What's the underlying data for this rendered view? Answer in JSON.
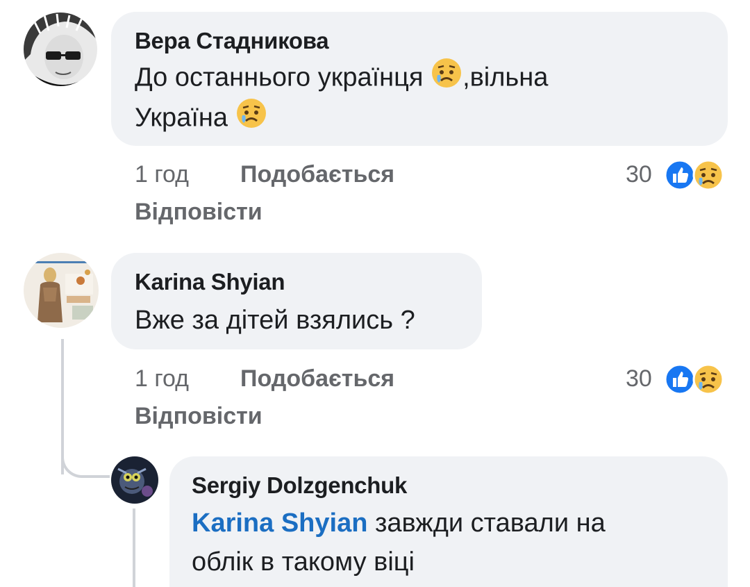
{
  "comments": [
    {
      "author": "Вера Стадникова",
      "text_line1_a": "До останнього українця",
      "text_line1_b": ",вільна",
      "text_line2": "Україна",
      "time": "1 год",
      "like_label": "Подобається",
      "reply_label": "Відповісти",
      "reaction_count": "30"
    },
    {
      "author": "Karina Shyian",
      "text": "Вже за дітей взялись ?",
      "time": "1 год",
      "like_label": "Подобається",
      "reply_label": "Відповісти",
      "reaction_count": "30"
    }
  ],
  "reply": {
    "author": "Sergiy Dolzgenchuk",
    "mention": "Karina Shyian",
    "text_line1": "завжди ставали на",
    "text_line2": "облік в такому віці"
  },
  "colors": {
    "bubble": "#f0f2f5",
    "like_blue": "#1877f2",
    "mention": "#1b6ec2",
    "meta": "#65676b"
  },
  "icons": [
    "sad-face-emoji",
    "like-reaction-icon",
    "sad-reaction-icon"
  ]
}
